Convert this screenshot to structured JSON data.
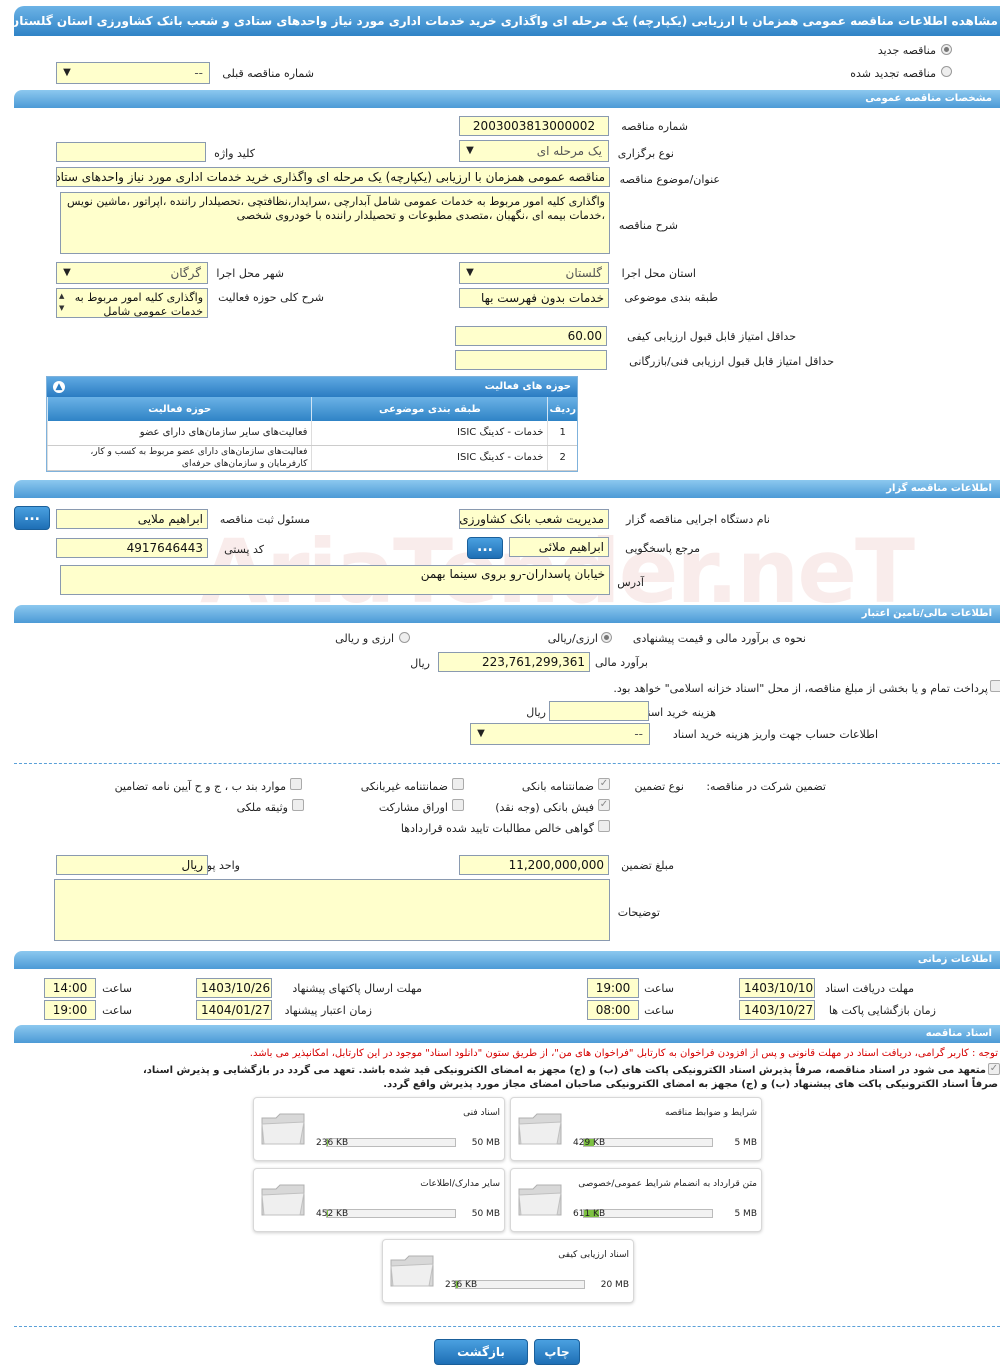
{
  "page_title": "مشاهده اطلاعات مناقصه عمومی همزمان با ارزیابی (یکپارچه) یک مرحله ای واگذاری خرید خدمات اداری مورد نیاز واحدهای ستادی و شعب بانک کشاورزی استان گلستان",
  "watermark": "AriaTender.neT",
  "top": {
    "radio_new": "مناقصه جدید",
    "radio_renewed": "مناقصه تجدید شده",
    "prev_number_label": "شماره مناقصه قبلی",
    "prev_number_value": "--"
  },
  "general": {
    "section": "مشخصات مناقصه عمومی",
    "number_label": "شماره مناقصه",
    "number_value": "2003003813000002",
    "type_label": "نوع برگزاری",
    "type_value": "یک مرحله ای",
    "keyword_label": "کلید واژه",
    "keyword_value": "",
    "subject_label": "عنوان/موضوع مناقصه",
    "subject_value": "مناقصه عمومی همزمان با ارزیابی (یکپارچه) یک مرحله ای واگذاری خرید خدمات اداری مورد نیاز واحدهای ستادی",
    "desc_label": "شرح مناقصه",
    "desc_value": "واگذاری کلیه امور مربوط به خدمات عمومی شامل آبدارچی ،سرایدار،نظافتچی ،تحصیلدار راننده ،اپراتور ،ماشین نویس ،خدمات بیمه ای ،نگهبان ،متصدی مطبوعات و تحصیلدار راننده با خودروی شخصی",
    "province_label": "استان محل اجرا",
    "province_value": "گلستان",
    "city_label": "شهر محل اجرا",
    "city_value": "گرگان",
    "category_label": "طبقه بندی موضوعی",
    "category_value": "خدمات بدون فهرست بها",
    "scope_label": "شرح کلی حوزه فعالیت",
    "scope_value": "واگذاری کلیه امور مربوط به خدمات عمومی شامل",
    "min_quality_label": "حداقل امتیاز قابل قبول ارزیابی کیفی",
    "min_quality_value": "60.00",
    "min_tech_label": "حداقل امتیاز قابل قبول ارزیابی فنی/بازرگانی",
    "min_tech_value": ""
  },
  "activities": {
    "title": "حوزه های فعالیت",
    "headers": [
      "ردیف",
      "طبقه بندی موضوعی",
      "حوزه فعالیت"
    ],
    "rows": [
      [
        "1",
        "خدمات - کدینگ ISIC",
        "فعالیت‌های سایر سازمان‌های دارای عضو"
      ],
      [
        "2",
        "خدمات - کدینگ ISIC",
        "فعالیت‌های سازمان‌های دارای عضو مربوط به کسب و کار، کارفرمایان و سازمان‌های حرفه‌ای"
      ]
    ]
  },
  "organizer": {
    "section": "اطلاعات مناقصه گزار",
    "org_label": "نام دستگاه اجرایی مناقصه گزار",
    "org_value": "مدیریت شعب بانک کشاورزی",
    "registrar_label": "مسئول ثبت مناقصه",
    "registrar_value": "ابراهیم ملایی",
    "reference_label": "مرجع پاسخگویی",
    "reference_value": "ابراهیم ملائی",
    "postal_label": "کد پستی",
    "postal_value": "4917646443",
    "address_label": "آدرس",
    "address_value": "خیابان پاسداران-رو بروی سینما بهمن",
    "more_btn": "..."
  },
  "financial": {
    "section": "اطلاعات مالی/تامین اعتبار",
    "method_label": "نحوه ی برآورد مالی و قیمت پیشنهادی",
    "opt_rial": "ارزی/ریالی",
    "opt_currency": "ارزی و ریالی",
    "estimate_label": "برآورد مالی",
    "estimate_value": "223,761,299,361",
    "unit_rial": "ریال",
    "treasury_text": "پرداخت تمام و یا بخشی از مبلغ مناقصه، از محل \"اسناد خزانه اسلامی\" خواهد بود.",
    "doc_fee_label": "هزینه خرید اسناد",
    "doc_fee_value": "",
    "account_label": "اطلاعات حساب جهت واریز هزینه خرید اسناد",
    "account_value": "--"
  },
  "guarantee": {
    "label": "تضمین شرکت در مناقصه:",
    "type_label": "نوع تضمین",
    "options": {
      "bank_guarantee": "ضمانتنامه بانکی",
      "non_bank": "ضمانتنامه غیربانکی",
      "clauses": "موارد بند ب ، ج و ح آیین نامه تضامین",
      "bank_receipt": "فیش بانکی (وجه نقد)",
      "bonds": "اوراق مشارکت",
      "property": "وثیقه ملکی",
      "net_claims": "گواهی خالص مطالبات تایید شده قراردادها"
    },
    "amount_label": "مبلغ تضمین",
    "amount_value": "11,200,000,000",
    "currency_label": "واحد پول",
    "currency_value": "ریال",
    "notes_label": "توضیحات",
    "notes_value": ""
  },
  "timing": {
    "section": "اطلاعات زمانی",
    "doc_deadline_label": "مهلت دریافت اسناد",
    "doc_deadline_date": "1403/10/10",
    "doc_deadline_time": "19:00",
    "submit_deadline_label": "مهلت ارسال پاکتهای پیشنهاد",
    "submit_deadline_date": "1403/10/26",
    "submit_deadline_time": "14:00",
    "opening_label": "زمان بازگشایی پاکت ها",
    "opening_date": "1403/10/27",
    "opening_time": "08:00",
    "validity_label": "زمان اعتبار پیشنهاد",
    "validity_date": "1404/01/27",
    "validity_time": "19:00",
    "time_label": "ساعت"
  },
  "documents": {
    "section": "اسناد مناقصه",
    "note": "توجه : کاربر گرامی، دریافت اسناد در مهلت قانونی و پس از افزودن فراخوان به کارتابل \"فراخوان های من\"، از طریق ستون \"دانلود اسناد\" موجود در این کارتابل، امکانپذیر می باشد.",
    "commit_line1": "متعهد می شود در اسناد مناقصه، صرفاً پذیرش اسناد الکترونیکی پاکت های (ب) و (ج) مجهز به امضای الکترونیکی قید شده باشد. تعهد می گردد در بازگشایی و پذیرش اسناد،",
    "commit_line2": "صرفاً اسناد الکترونیکی پاکت های پیشنهاد (ب) و (ج) مجهز به امضای الکترونیکی صاحبان امضای مجاز مورد پذیرش واقع گردد.",
    "files": [
      {
        "name": "شرایط و ضوابط مناقصه",
        "size": "429 KB",
        "max": "5 MB",
        "fill": 0.08
      },
      {
        "name": "اسناد فنی",
        "size": "236 KB",
        "max": "50 MB",
        "fill": 0.005
      },
      {
        "name": "متن قرارداد به انضمام شرایط عمومی/خصوصی",
        "size": "611 KB",
        "max": "5 MB",
        "fill": 0.12
      },
      {
        "name": "سایر مدارک/اطلاعات",
        "size": "452 KB",
        "max": "50 MB",
        "fill": 0.01
      },
      {
        "name": "اسناد ارزیابی کیفی",
        "size": "236 KB",
        "max": "20 MB",
        "fill": 0.012
      }
    ]
  },
  "footer": {
    "print": "چاپ",
    "back": "بازگشت"
  }
}
